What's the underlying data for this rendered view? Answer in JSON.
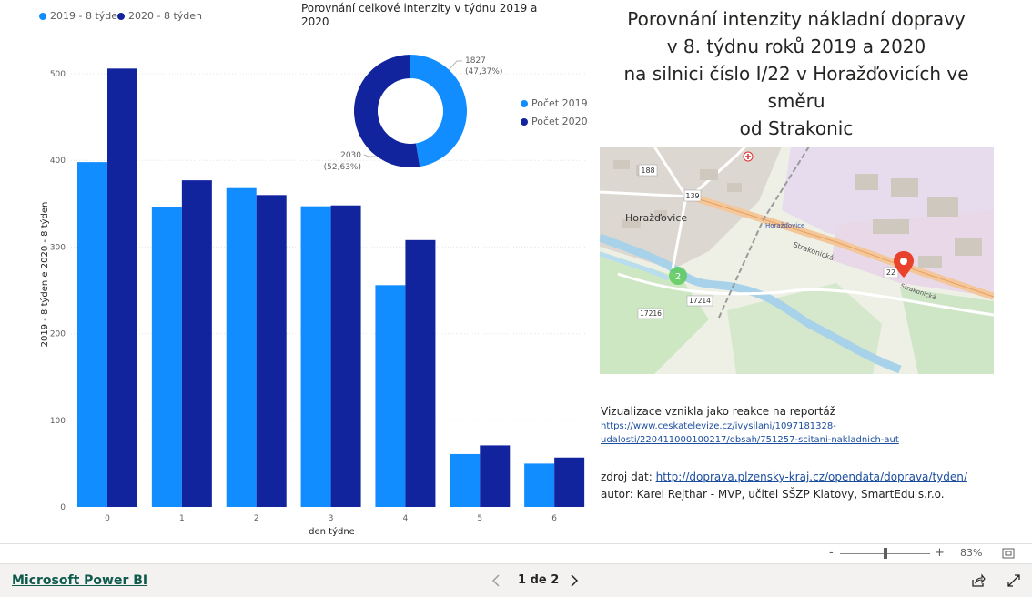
{
  "bar_chart": {
    "legend": [
      {
        "label": "2019 - 8 týden",
        "color": "#118dff"
      },
      {
        "label": "2020 - 8 týden",
        "color": "#12239e"
      }
    ],
    "ylabel": "2019 - 8 týden e 2020 - 8 týden",
    "xlabel": "den týdne",
    "y_ticks": [
      "0",
      "100",
      "200",
      "300",
      "400",
      "500"
    ],
    "categories": [
      "0",
      "1",
      "2",
      "3",
      "4",
      "5",
      "6"
    ]
  },
  "donut_chart": {
    "title": "Porovnání celkové intenzity v týdnu 2019 a 2020",
    "legend": [
      {
        "label": "Počet 2019",
        "color": "#118dff"
      },
      {
        "label": "Počet 2020",
        "color": "#12239e"
      }
    ],
    "label_2019_value": "1827",
    "label_2019_pct": "(47,37%)",
    "label_2020_value": "2030",
    "label_2020_pct": "(52,63%)"
  },
  "chart_data": [
    {
      "type": "bar",
      "title": "",
      "xlabel": "den týdne",
      "ylabel": "2019 - 8 týden e 2020 - 8 týden",
      "categories": [
        "0",
        "1",
        "2",
        "3",
        "4",
        "5",
        "6"
      ],
      "ylim": [
        0,
        520
      ],
      "grid": true,
      "legend_position": "top-left",
      "series": [
        {
          "name": "2019 - 8 týden",
          "color": "#118dff",
          "values": [
            398,
            346,
            368,
            347,
            256,
            61,
            50
          ]
        },
        {
          "name": "2020 - 8 týden",
          "color": "#12239e",
          "values": [
            506,
            377,
            360,
            348,
            308,
            71,
            57
          ]
        }
      ]
    },
    {
      "type": "pie",
      "title": "Porovnání celkové intenzity v týdnu 2019 a 2020",
      "donut": true,
      "legend_position": "right",
      "categories": [
        "Počet 2019",
        "Počet 2020"
      ],
      "values": [
        1827,
        2030
      ],
      "colors": [
        "#118dff",
        "#12239e"
      ]
    }
  ],
  "report_title": {
    "line1": "Porovnání intenzity nákladní dopravy",
    "line2": "v 8. týdnu roků 2019 a 2020",
    "line3": "na silnici číslo I/22 v Horažďovicích ve směru",
    "line4": "od Strakonic"
  },
  "map": {
    "labels": {
      "town": "Horažďovice",
      "town_small": "Horažďovice",
      "street": "Strakonická",
      "road_22": "22",
      "road_139": "139",
      "road_188": "188",
      "road_17214": "17214",
      "road_17216": "17216",
      "cluster": "2"
    }
  },
  "info": {
    "intro": "Vizualizace vznikla jako reakce na reportáž",
    "link_line1": "https://www.ceskatelevize.cz/ivysilani/1097181328-",
    "link_line2": "udalosti/220411000100217/obsah/751257-scitani-nakladnich-aut",
    "source_label": "zdroj dat: ",
    "source_link": "http://doprava.plzensky-kraj.cz/opendata/doprava/tyden/",
    "author": "autor: Karel Rejthar - MVP, učitel SŠZP Klatovy, SmartEdu s.r.o."
  },
  "zoom": {
    "minus": "-",
    "plus": "+",
    "percent": "83%",
    "level": 0.5
  },
  "footer": {
    "brand": "Microsoft Power BI",
    "page_indicator": "1 de 2"
  }
}
